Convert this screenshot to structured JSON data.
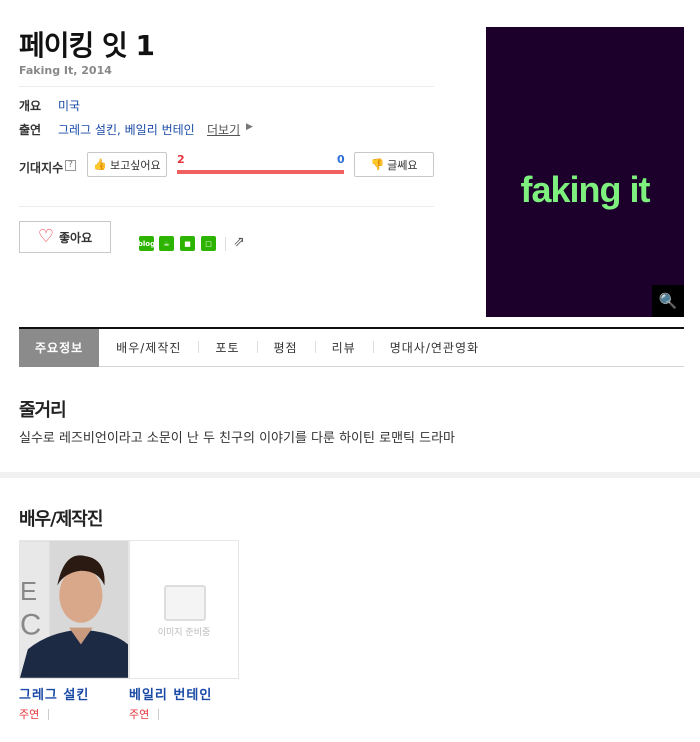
{
  "title": "페이킹 잇 1",
  "subtitle": "Faking It, 2014",
  "info": {
    "overview_label": "개요",
    "overview_value": "미국",
    "cast_label": "출연",
    "cast_value": "그레그 설킨, 베일리 번테인",
    "more_label": "더보기"
  },
  "expect": {
    "label": "기대지수",
    "help": "?",
    "want_label": "보고싶어요",
    "meh_label": "글쎄요",
    "want_count": "2",
    "meh_count": "0",
    "want_ratio": 1.0
  },
  "like_label": "좋아요",
  "share_items": [
    {
      "name": "blog",
      "text": "blog",
      "color": "#2db400"
    },
    {
      "name": "cafe",
      "text": "☕",
      "color": "#2db400"
    },
    {
      "name": "bookmark",
      "text": "■",
      "color": "#2db400"
    },
    {
      "name": "memo",
      "text": "□",
      "color": "#2db400"
    }
  ],
  "poster": {
    "text": "faking it",
    "bg": "#1c002b",
    "text_color": "#7ef07e"
  },
  "tabs": [
    {
      "label": "주요정보",
      "active": true
    },
    {
      "label": "배우/제작진",
      "active": false
    },
    {
      "label": "포토",
      "active": false
    },
    {
      "label": "평점",
      "active": false
    },
    {
      "label": "리뷰",
      "active": false
    },
    {
      "label": "명대사/연관영화",
      "active": false
    }
  ],
  "synopsis": {
    "heading": "줄거리",
    "text": "실수로 레즈비언이라고 소문이 난 두 친구의 이야기를 다룬 하이틴 로맨틱 드라마"
  },
  "cast_section": {
    "heading": "배우/제작진",
    "members": [
      {
        "name": "그레그 설킨",
        "role": "주연"
      },
      {
        "name": "베일리 번테인",
        "role": "주연",
        "placeholder": "이미지 준비중"
      }
    ]
  }
}
